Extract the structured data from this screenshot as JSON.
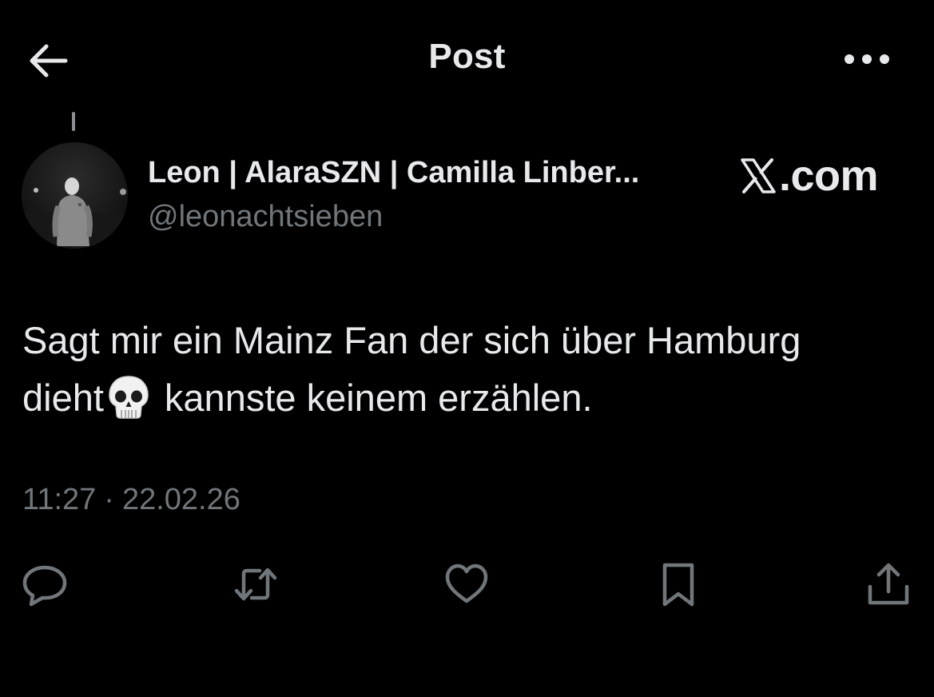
{
  "header": {
    "back_icon": "arrow-left-icon",
    "title": "Post",
    "more_icon": "more-horizontal-icon"
  },
  "author": {
    "display_name": "Leon | AlaraSZN | Camilla Linber...",
    "handle": "@leonachtsieben",
    "avatar": "profile-photo"
  },
  "brand": {
    "icon": "x-logo-icon",
    "text": ".com"
  },
  "post": {
    "text_line1": "Sagt mir ein Mainz Fan der sich über Hamburg",
    "text_line2_before": "dieht",
    "emoji": "skull-emoji",
    "text_line2_after": "kannste keinem erzählen."
  },
  "meta": {
    "time": "11:27",
    "separator": "·",
    "date": "22.02.26"
  },
  "actions": [
    {
      "name": "reply",
      "icon": "reply-icon"
    },
    {
      "name": "repost",
      "icon": "repost-icon"
    },
    {
      "name": "like",
      "icon": "heart-icon"
    },
    {
      "name": "bookmark",
      "icon": "bookmark-icon"
    },
    {
      "name": "share",
      "icon": "share-icon"
    }
  ],
  "colors": {
    "background": "#000000",
    "primary_text": "#e7e9ea",
    "secondary_text": "#71767b"
  }
}
